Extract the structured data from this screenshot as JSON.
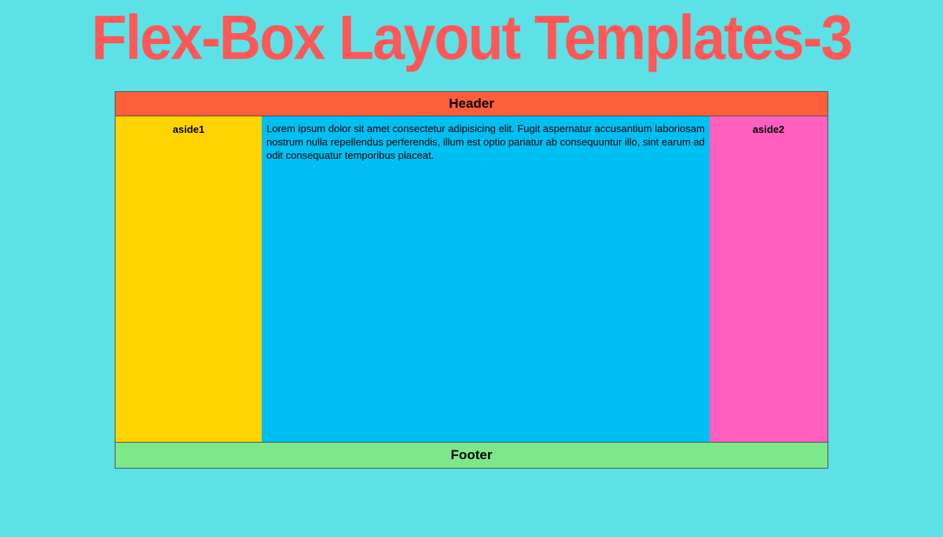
{
  "title": "Flex-Box Layout Templates-3",
  "header": "Header",
  "aside1": "aside1",
  "aside2": "aside2",
  "main_text": "Lorem ipsum dolor sit amet consectetur adipisicing elit. Fugit aspernatur accusantium laboriosam nostrum nulla repellendus perferendis, illum est optio pariatur ab consequuntur illo, sint earum ad odit consequatur temporibus placeat.",
  "footer": "Footer",
  "colors": {
    "background": "#5CE1E6",
    "title": "#FF5757",
    "header": "#FF5E3A",
    "aside1": "#FFD400",
    "main": "#00BFF3",
    "aside2": "#FF5FBF",
    "footer": "#7CE88A"
  }
}
